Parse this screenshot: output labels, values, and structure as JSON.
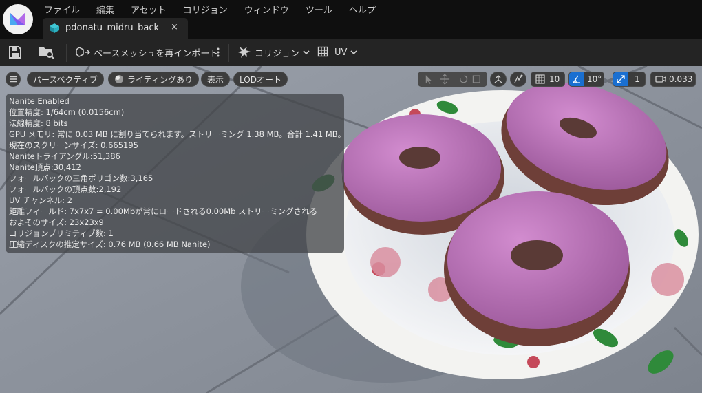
{
  "menu": [
    "ファイル",
    "編集",
    "アセット",
    "コリジョン",
    "ウィンドウ",
    "ツール",
    "ヘルプ"
  ],
  "tab": {
    "title": "pdonatu_midru_back",
    "close": "×"
  },
  "toolbar": {
    "base_mesh_label": "ベースメッシュを再インポート",
    "collision_label": "コリジョン",
    "uv_label": "UV"
  },
  "viewport": {
    "perspective": "パースペクティブ",
    "lighting": "ライティングあり",
    "show": "表示",
    "lod": "LODオート",
    "grid_snap": "10",
    "angle_snap": "10°",
    "scale_snap": "1",
    "camera_speed": "0.033"
  },
  "stats": [
    "Nanite Enabled",
    "位置精度: 1/64cm (0.0156cm)",
    "法線精度: 8 bits",
    "GPU メモリ: 常に 0.03 MB に割り当てられます。ストリーミング 1.38 MB。合計 1.41 MB。",
    "現在のスクリーンサイズ: 0.665195",
    "Naniteトライアングル:51,386",
    "Nanite頂点:30,412",
    "フォールバックの三角ポリゴン数:3,165",
    "フォールバックの頂点数:2,192",
    "UV チャンネル: 2",
    "距離フィールド: 7x7x7 = 0.00Mbが常にロードされる0.00Mb ストリーミングされる",
    "およそのサイズ: 23x23x9",
    "コリジョンプリミティブ数: 1",
    "圧縮ディスクの推定サイズ: 0.76 MB (0.66 MB Nanite)"
  ],
  "colors": {
    "accent_blue": "#1a6fd1",
    "donut_frosting": "#b86fb6",
    "panel": "#242424"
  }
}
